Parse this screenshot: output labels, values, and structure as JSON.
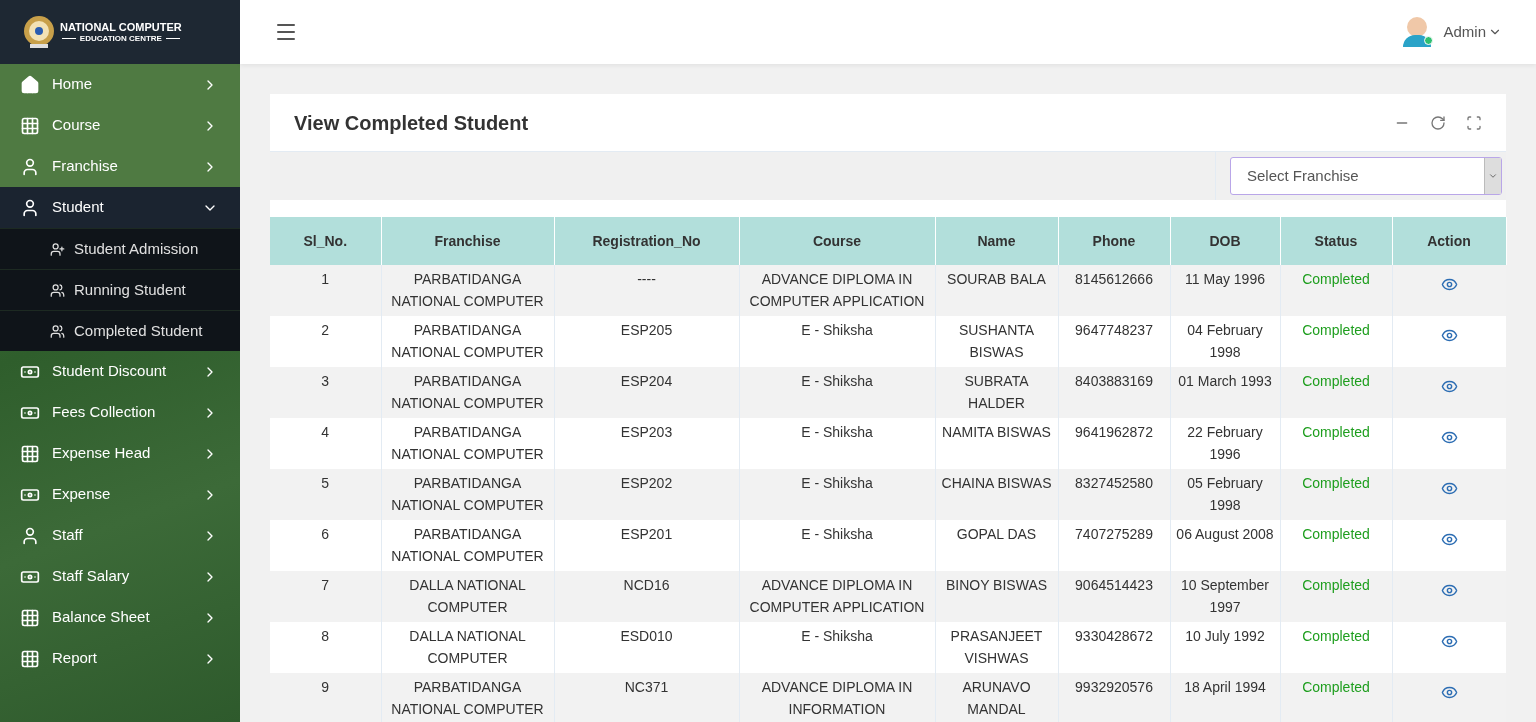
{
  "brand": {
    "title": "NATIONAL COMPUTER",
    "subtitle": "EDUCATION CENTRE"
  },
  "sidebar": {
    "items": [
      {
        "label": "Home",
        "kind": "home",
        "expanded": false
      },
      {
        "label": "Course",
        "kind": "grid",
        "expanded": false
      },
      {
        "label": "Franchise",
        "kind": "user",
        "expanded": false
      },
      {
        "label": "Student",
        "kind": "user",
        "expanded": true,
        "children": [
          {
            "label": "Student Admission",
            "kind": "userplus"
          },
          {
            "label": "Running Student",
            "kind": "users"
          },
          {
            "label": "Completed Student",
            "kind": "users"
          }
        ]
      },
      {
        "label": "Student Discount",
        "kind": "money",
        "expanded": false
      },
      {
        "label": "Fees Collection",
        "kind": "money",
        "expanded": false
      },
      {
        "label": "Expense Head",
        "kind": "grid",
        "expanded": false
      },
      {
        "label": "Expense",
        "kind": "money",
        "expanded": false
      },
      {
        "label": "Staff",
        "kind": "user",
        "expanded": false
      },
      {
        "label": "Staff Salary",
        "kind": "money",
        "expanded": false
      },
      {
        "label": "Balance Sheet",
        "kind": "grid",
        "expanded": false
      },
      {
        "label": "Report",
        "kind": "grid",
        "expanded": false
      }
    ]
  },
  "topbar": {
    "user": "Admin"
  },
  "card": {
    "title": "View Completed Student",
    "filter": {
      "placeholder": "Select Franchise"
    }
  },
  "table": {
    "columns": [
      "Sl_No.",
      "Franchise",
      "Registration_No",
      "Course",
      "Name",
      "Phone",
      "DOB",
      "Status",
      "Action"
    ],
    "rows": [
      {
        "sl": "1",
        "franchise": "PARBATIDANGA NATIONAL COMPUTER",
        "reg": "----",
        "course": "ADVANCE DIPLOMA IN COMPUTER APPLICATION",
        "name": "SOURAB BALA",
        "phone": "8145612666",
        "dob": "11 May 1996",
        "status": "Completed"
      },
      {
        "sl": "2",
        "franchise": "PARBATIDANGA NATIONAL COMPUTER",
        "reg": "ESP205",
        "course": "E - Shiksha",
        "name": "SUSHANTA BISWAS",
        "phone": "9647748237",
        "dob": "04 February 1998",
        "status": "Completed"
      },
      {
        "sl": "3",
        "franchise": "PARBATIDANGA NATIONAL COMPUTER",
        "reg": "ESP204",
        "course": "E - Shiksha",
        "name": "SUBRATA HALDER",
        "phone": "8403883169",
        "dob": "01 March 1993",
        "status": "Completed"
      },
      {
        "sl": "4",
        "franchise": "PARBATIDANGA NATIONAL COMPUTER",
        "reg": "ESP203",
        "course": "E - Shiksha",
        "name": "NAMITA BISWAS",
        "phone": "9641962872",
        "dob": "22 February 1996",
        "status": "Completed"
      },
      {
        "sl": "5",
        "franchise": "PARBATIDANGA NATIONAL COMPUTER",
        "reg": "ESP202",
        "course": "E - Shiksha",
        "name": "CHAINA BISWAS",
        "phone": "8327452580",
        "dob": "05 February 1998",
        "status": "Completed"
      },
      {
        "sl": "6",
        "franchise": "PARBATIDANGA NATIONAL COMPUTER",
        "reg": "ESP201",
        "course": "E - Shiksha",
        "name": "GOPAL DAS",
        "phone": "7407275289",
        "dob": "06 August 2008",
        "status": "Completed"
      },
      {
        "sl": "7",
        "franchise": "DALLA NATIONAL COMPUTER",
        "reg": "NCD16",
        "course": "ADVANCE DIPLOMA IN COMPUTER APPLICATION",
        "name": "BINOY BISWAS",
        "phone": "9064514423",
        "dob": "10 September 1997",
        "status": "Completed"
      },
      {
        "sl": "8",
        "franchise": "DALLA NATIONAL COMPUTER",
        "reg": "ESD010",
        "course": "E - Shiksha",
        "name": "PRASANJEET VISHWAS",
        "phone": "9330428672",
        "dob": "10 July 1992",
        "status": "Completed"
      },
      {
        "sl": "9",
        "franchise": "PARBATIDANGA NATIONAL COMPUTER",
        "reg": "NC371",
        "course": "ADVANCE DIPLOMA IN INFORMATION",
        "name": "ARUNAVO MANDAL",
        "phone": "9932920576",
        "dob": "18 April 1994",
        "status": "Completed"
      }
    ]
  }
}
